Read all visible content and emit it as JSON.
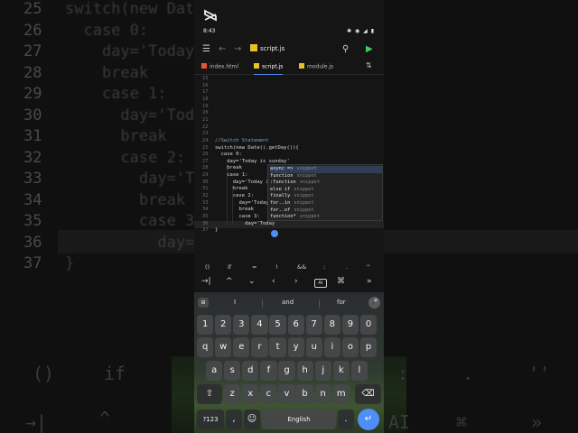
{
  "backdrop": {
    "line_numbers": [
      "25",
      "26",
      "27",
      "28",
      "29",
      "30",
      "31",
      "32",
      "33",
      "34",
      "35",
      "36",
      "37"
    ],
    "code_lines": [
      "switch(new Date",
      "  case 0:",
      "    day='Today",
      "    break",
      "    case 1:",
      "      day='Today",
      "      break",
      "      case 2:",
      "        day='Tie",
      "        break",
      "        case 3:",
      "          day='",
      "}"
    ],
    "bottom_symbols": [
      "()",
      "if",
      "=",
      ":",
      ".",
      "''"
    ],
    "bottom_nav": [
      "→|",
      "^",
      "⌘",
      "»"
    ],
    "bottom_ai": "AI"
  },
  "status_bar": {
    "time": "8:43",
    "icons": "✱ ◉ ◢ ▮"
  },
  "toolbar": {
    "menu_icon": "☰",
    "back_icon": "←",
    "forward_icon": "→",
    "file_name": "script.js",
    "search_icon": "⚲",
    "run_icon": "▶"
  },
  "tabs": [
    {
      "label": "index.html",
      "color": "#e4572e",
      "active": false
    },
    {
      "label": "script.js",
      "color": "#e6c229",
      "active": true
    },
    {
      "label": "module.js",
      "color": "#e6c229",
      "active": false
    }
  ],
  "sort_icon": "⇅",
  "editor": {
    "line_numbers": [
      "15",
      "16",
      "17",
      "18",
      "19",
      "20",
      "21",
      "22",
      "23",
      "24",
      "25",
      "26",
      "27",
      "28",
      "29",
      "30",
      "31",
      "32",
      "33",
      "34",
      "35",
      "36",
      "37"
    ],
    "lines": [
      "",
      "",
      "",
      "",
      "",
      "",
      "",
      "",
      "",
      "//Switch Statement",
      "switch(new Date().getDay()){",
      "  case 0:",
      "    day='Today is sunday'",
      "    break",
      "    case 1:",
      "      day='Today is",
      "      break",
      "      case 2:",
      "        day='Today",
      "        break",
      "        case 3:",
      "          day='Today",
      "}"
    ]
  },
  "autocomplete": [
    {
      "label": "async =>",
      "detail": "snippet"
    },
    {
      "label": "function",
      "detail": "snippet"
    },
    {
      "label": ":function",
      "detail": "snippet"
    },
    {
      "label": "else if",
      "detail": "snippet"
    },
    {
      "label": "finally",
      "detail": "snippet"
    },
    {
      "label": "for..in",
      "detail": "snippet"
    },
    {
      "label": "for..of",
      "detail": "snippet"
    },
    {
      "label": "function*",
      "detail": "snippet"
    }
  ],
  "symbol_bar": [
    "()",
    "if",
    "=",
    "!",
    "&&",
    ":",
    ".",
    "''"
  ],
  "nav_bar": [
    "→|",
    "^",
    "⌄",
    "‹",
    "›",
    "AI",
    "⌘",
    "»"
  ],
  "keyboard": {
    "grid_icon": "⊞",
    "suggestions": [
      "I",
      "and",
      "for"
    ],
    "mic_icon": "🎤",
    "row_numbers": [
      "1",
      "2",
      "3",
      "4",
      "5",
      "6",
      "7",
      "8",
      "9",
      "0"
    ],
    "row_q": [
      "q",
      "w",
      "e",
      "r",
      "t",
      "y",
      "u",
      "i",
      "o",
      "p"
    ],
    "row_a": [
      "a",
      "s",
      "d",
      "f",
      "g",
      "h",
      "j",
      "k",
      "l"
    ],
    "row_z": [
      "z",
      "x",
      "c",
      "v",
      "b",
      "n",
      "m"
    ],
    "shift": "⇧",
    "backspace": "⌫",
    "symbols_key": "?123",
    "comma": ",",
    "emoji": "☺",
    "space_label": "English",
    "period": ".",
    "enter": "↵"
  }
}
